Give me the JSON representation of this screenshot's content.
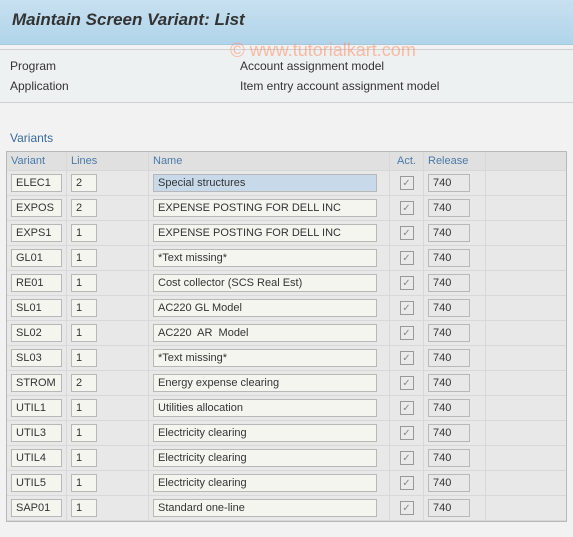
{
  "header": {
    "title": "Maintain Screen Variant: List"
  },
  "info": {
    "program_label": "Program",
    "program_value": "Account assignment model",
    "application_label": "Application",
    "application_value": "Item entry account assignment model"
  },
  "variants": {
    "section_title": "Variants",
    "columns": {
      "variant": "Variant",
      "lines": "Lines",
      "name": "Name",
      "act": "Act.",
      "release": "Release"
    },
    "rows": [
      {
        "variant": "ELEC1",
        "lines": "2",
        "name": "Special structures",
        "act": true,
        "release": "740",
        "selected": true
      },
      {
        "variant": "EXPOS",
        "lines": "2",
        "name": "EXPENSE POSTING FOR DELL INC",
        "act": true,
        "release": "740"
      },
      {
        "variant": "EXPS1",
        "lines": "1",
        "name": "EXPENSE POSTING FOR DELL INC",
        "act": true,
        "release": "740"
      },
      {
        "variant": "GL01",
        "lines": "1",
        "name": "*Text missing*",
        "act": true,
        "release": "740"
      },
      {
        "variant": "RE01",
        "lines": "1",
        "name": "Cost collector (SCS Real Est)",
        "act": true,
        "release": "740"
      },
      {
        "variant": "SL01",
        "lines": "1",
        "name": "AC220 GL Model",
        "act": true,
        "release": "740"
      },
      {
        "variant": "SL02",
        "lines": "1",
        "name": "AC220  AR  Model",
        "act": true,
        "release": "740"
      },
      {
        "variant": "SL03",
        "lines": "1",
        "name": "*Text missing*",
        "act": true,
        "release": "740"
      },
      {
        "variant": "STROM",
        "lines": "2",
        "name": "Energy expense clearing",
        "act": true,
        "release": "740"
      },
      {
        "variant": "UTIL1",
        "lines": "1",
        "name": "Utilities allocation",
        "act": true,
        "release": "740"
      },
      {
        "variant": "UTIL3",
        "lines": "1",
        "name": "Electricity clearing",
        "act": true,
        "release": "740"
      },
      {
        "variant": "UTIL4",
        "lines": "1",
        "name": "Electricity clearing",
        "act": true,
        "release": "740"
      },
      {
        "variant": "UTIL5",
        "lines": "1",
        "name": "Electricity clearing",
        "act": true,
        "release": "740"
      },
      {
        "variant": "SAP01",
        "lines": "1",
        "name": "Standard one-line",
        "act": true,
        "release": "740"
      }
    ]
  },
  "watermark": "www.tutorialkart.com"
}
